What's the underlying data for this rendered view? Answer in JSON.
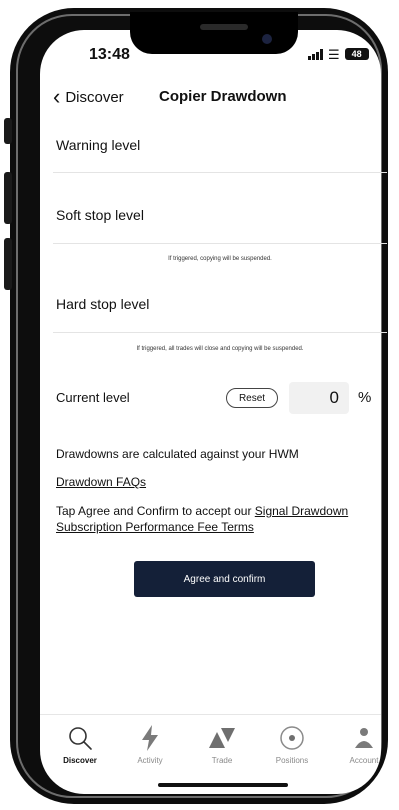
{
  "status_bar": {
    "time": "13:48",
    "battery": "48"
  },
  "nav": {
    "back_label": "Discover",
    "title": "Copier Drawdown"
  },
  "form": {
    "warning_label": "Warning level",
    "soft_stop_label": "Soft stop level",
    "soft_stop_hint": "If triggered, copying will be suspended.",
    "hard_stop_label": "Hard stop level",
    "hard_stop_hint": "If triggered, all trades will close and copying will be suspended.",
    "current_label": "Current level",
    "reset_label": "Reset",
    "current_value": "0",
    "unit": "%"
  },
  "info": {
    "hwm_text": "Drawdowns are calculated against your HWM",
    "faq_link": "Drawdown FAQs",
    "terms_prefix": "Tap Agree and Confirm to accept our ",
    "terms_link": "Signal Drawdown Subscription Performance Fee Terms"
  },
  "actions": {
    "agree_label": "Agree and confirm"
  },
  "tabbar": {
    "items": [
      {
        "label": "Discover",
        "icon": "search-icon",
        "active": true
      },
      {
        "label": "Activity",
        "icon": "lightning-icon",
        "active": false
      },
      {
        "label": "Trade",
        "icon": "trade-arrows-icon",
        "active": false
      },
      {
        "label": "Positions",
        "icon": "positions-icon",
        "active": false
      },
      {
        "label": "Account",
        "icon": "person-icon",
        "active": false
      }
    ]
  },
  "colors": {
    "primary_button": "#142038",
    "active_tab": "#111111",
    "inactive_tab": "#8a8a8a"
  }
}
